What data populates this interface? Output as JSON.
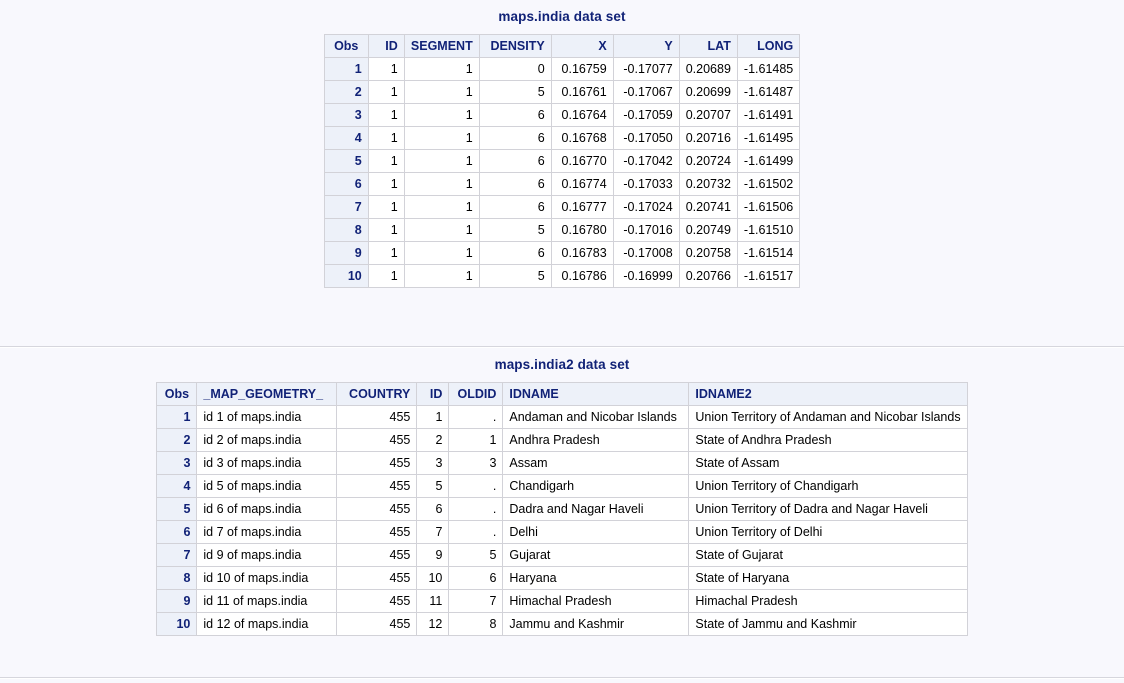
{
  "page": {
    "background_color": "#f8f8fd",
    "title_color": "#112277",
    "header_bg_color": "#edf1f9",
    "border_color": "#d2d2d8"
  },
  "sections": [
    {
      "id": "india",
      "title": "maps.india data set"
    },
    {
      "id": "india2",
      "title": "maps.india2 data set"
    }
  ],
  "tables": {
    "india": {
      "title": "maps.india data set",
      "columns": [
        "Obs",
        "ID",
        "SEGMENT",
        "DENSITY",
        "X",
        "Y",
        "LAT",
        "LONG"
      ],
      "rows": [
        [
          "1",
          "1",
          "1",
          "0",
          "0.16759",
          "-0.17077",
          "0.20689",
          "-1.61485"
        ],
        [
          "2",
          "1",
          "1",
          "5",
          "0.16761",
          "-0.17067",
          "0.20699",
          "-1.61487"
        ],
        [
          "3",
          "1",
          "1",
          "6",
          "0.16764",
          "-0.17059",
          "0.20707",
          "-1.61491"
        ],
        [
          "4",
          "1",
          "1",
          "6",
          "0.16768",
          "-0.17050",
          "0.20716",
          "-1.61495"
        ],
        [
          "5",
          "1",
          "1",
          "6",
          "0.16770",
          "-0.17042",
          "0.20724",
          "-1.61499"
        ],
        [
          "6",
          "1",
          "1",
          "6",
          "0.16774",
          "-0.17033",
          "0.20732",
          "-1.61502"
        ],
        [
          "7",
          "1",
          "1",
          "6",
          "0.16777",
          "-0.17024",
          "0.20741",
          "-1.61506"
        ],
        [
          "8",
          "1",
          "1",
          "5",
          "0.16780",
          "-0.17016",
          "0.20749",
          "-1.61510"
        ],
        [
          "9",
          "1",
          "1",
          "6",
          "0.16783",
          "-0.17008",
          "0.20758",
          "-1.61514"
        ],
        [
          "10",
          "1",
          "1",
          "5",
          "0.16786",
          "-0.16999",
          "0.20766",
          "-1.61517"
        ]
      ]
    },
    "india2": {
      "title": "maps.india2 data set",
      "columns": [
        "Obs",
        "_MAP_GEOMETRY_",
        "COUNTRY",
        "ID",
        "OLDID",
        "IDNAME",
        "IDNAME2"
      ],
      "rows": [
        [
          "1",
          "id 1 of maps.india",
          "455",
          "1",
          ".",
          "Andaman and Nicobar Islands",
          "Union Territory of Andaman and Nicobar Islands"
        ],
        [
          "2",
          "id 2 of maps.india",
          "455",
          "2",
          "1",
          "Andhra Pradesh",
          "State of Andhra Pradesh"
        ],
        [
          "3",
          "id 3 of maps.india",
          "455",
          "3",
          "3",
          "Assam",
          "State of Assam"
        ],
        [
          "4",
          "id 5 of maps.india",
          "455",
          "5",
          ".",
          "Chandigarh",
          "Union Territory of Chandigarh"
        ],
        [
          "5",
          "id 6 of maps.india",
          "455",
          "6",
          ".",
          "Dadra and Nagar Haveli",
          "Union Territory of Dadra and Nagar Haveli"
        ],
        [
          "6",
          "id 7 of maps.india",
          "455",
          "7",
          ".",
          "Delhi",
          "Union Territory of Delhi"
        ],
        [
          "7",
          "id 9 of maps.india",
          "455",
          "9",
          "5",
          "Gujarat",
          "State of Gujarat"
        ],
        [
          "8",
          "id 10 of maps.india",
          "455",
          "10",
          "6",
          "Haryana",
          "State of Haryana"
        ],
        [
          "9",
          "id 11 of maps.india",
          "455",
          "11",
          "7",
          "Himachal Pradesh",
          "Himachal Pradesh"
        ],
        [
          "10",
          "id 12 of maps.india",
          "455",
          "12",
          "8",
          "Jammu and Kashmir",
          "State of Jammu and Kashmir"
        ]
      ]
    }
  }
}
